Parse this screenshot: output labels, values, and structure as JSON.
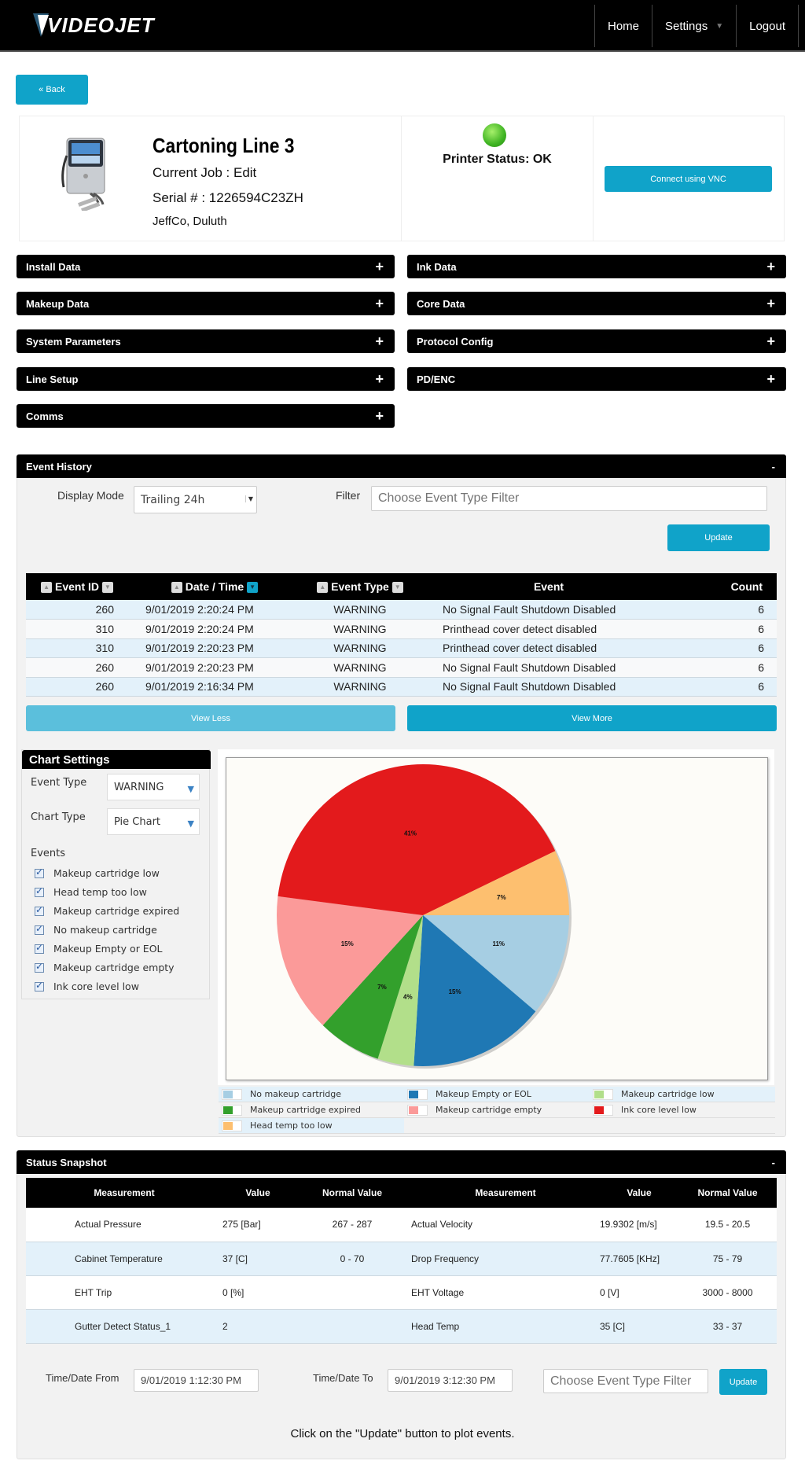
{
  "header": {
    "logo_text": "VIDEOJET",
    "nav": [
      {
        "label": "Home"
      },
      {
        "label": "Settings",
        "has_dropdown": true
      },
      {
        "label": "Logout"
      }
    ]
  },
  "back_button": "« Back",
  "printer": {
    "name": "Cartoning Line 3",
    "current_job": "Current Job : Edit",
    "serial": "Serial # : 1226594C23ZH",
    "location": "JeffCo, Duluth",
    "status_text": "Printer Status: OK",
    "status_color": "#3fb423",
    "vnc_button": "Connect using VNC"
  },
  "accordions": {
    "left": [
      "Install Data",
      "Makeup Data",
      "System Parameters",
      "Line Setup",
      "Comms"
    ],
    "right": [
      "Ink Data",
      "Core Data",
      "Protocol Config",
      "PD/ENC"
    ],
    "expand_icon": "+"
  },
  "event_history": {
    "title": "Event History",
    "collapse_icon": "-",
    "display_mode_label": "Display Mode",
    "display_mode_value": "Trailing 24h",
    "filter_label": "Filter",
    "filter_placeholder": "Choose Event Type Filter",
    "update_button": "Update",
    "columns": [
      "Event ID",
      "Date / Time",
      "Event Type",
      "Event",
      "Count"
    ],
    "rows": [
      {
        "id": "260",
        "datetime": "9/01/2019 2:20:24 PM",
        "type": "WARNING",
        "event": "No Signal Fault Shutdown Disabled",
        "count": "6"
      },
      {
        "id": "310",
        "datetime": "9/01/2019 2:20:24 PM",
        "type": "WARNING",
        "event": "Printhead cover detect disabled",
        "count": "6"
      },
      {
        "id": "310",
        "datetime": "9/01/2019 2:20:23 PM",
        "type": "WARNING",
        "event": "Printhead cover detect disabled",
        "count": "6"
      },
      {
        "id": "260",
        "datetime": "9/01/2019 2:20:23 PM",
        "type": "WARNING",
        "event": "No Signal Fault Shutdown Disabled",
        "count": "6"
      },
      {
        "id": "260",
        "datetime": "9/01/2019 2:16:34 PM",
        "type": "WARNING",
        "event": "No Signal Fault Shutdown Disabled",
        "count": "6"
      }
    ],
    "view_less": "View Less",
    "view_more": "View More"
  },
  "chart_settings": {
    "title": "Chart Settings",
    "event_type_label": "Event Type",
    "event_type_value": "WARNING",
    "chart_type_label": "Chart Type",
    "chart_type_value": "Pie Chart",
    "events_label": "Events",
    "events": [
      {
        "label": "Makeup cartridge low",
        "checked": true
      },
      {
        "label": "Head temp too low",
        "checked": true
      },
      {
        "label": "Makeup cartridge expired",
        "checked": true
      },
      {
        "label": "No makeup cartridge",
        "checked": true
      },
      {
        "label": "Makeup Empty or EOL",
        "checked": true
      },
      {
        "label": "Makeup cartridge empty",
        "checked": true
      },
      {
        "label": "Ink core level low",
        "checked": true
      }
    ]
  },
  "chart_data": {
    "type": "pie",
    "title": "",
    "unit": "%",
    "start": "3 o'clock, clockwise",
    "slices": [
      {
        "label": "No makeup cartridge",
        "value": 11,
        "color": "#a6cee3"
      },
      {
        "label": "Makeup Empty or EOL",
        "value": 15,
        "color": "#1f78b4"
      },
      {
        "label": "Makeup cartridge low",
        "value": 4,
        "color": "#b2df8a"
      },
      {
        "label": "Makeup cartridge expired",
        "value": 7,
        "color": "#33a02c"
      },
      {
        "label": "Makeup cartridge empty",
        "value": 15,
        "color": "#fb9a99"
      },
      {
        "label": "Ink core level low",
        "value": 41,
        "color": "#e31a1c"
      },
      {
        "label": "Head temp too low",
        "value": 7,
        "color": "#fdbf6f"
      }
    ],
    "legend_position": "bottom"
  },
  "status_snapshot": {
    "title": "Status Snapshot",
    "collapse_icon": "-",
    "columns": [
      "Measurement",
      "Value",
      "Normal Value",
      "Measurement",
      "Value",
      "Normal Value"
    ],
    "rows": [
      [
        "Actual Pressure",
        "275 [Bar]",
        "267 - 287",
        "Actual Velocity",
        "19.9302 [m/s]",
        "19.5 - 20.5"
      ],
      [
        "Cabinet Temperature",
        "37 [C]",
        "0 - 70",
        "Drop Frequency",
        "77.7605 [KHz]",
        "75 - 79"
      ],
      [
        "EHT Trip",
        "0 [%]",
        "",
        "EHT Voltage",
        "0 [V]",
        "3000 - 8000"
      ],
      [
        "Gutter Detect Status_1",
        "2",
        "",
        "Head Temp",
        "35 [C]",
        "33 - 37"
      ]
    ],
    "from_label": "Time/Date From",
    "from_value": "9/01/2019 1:12:30 PM",
    "to_label": "Time/Date To",
    "to_value": "9/01/2019 3:12:30 PM",
    "filter_placeholder": "Choose Event Type Filter",
    "update_button": "Update",
    "hint": "Click on the \"Update\" button to plot events."
  }
}
